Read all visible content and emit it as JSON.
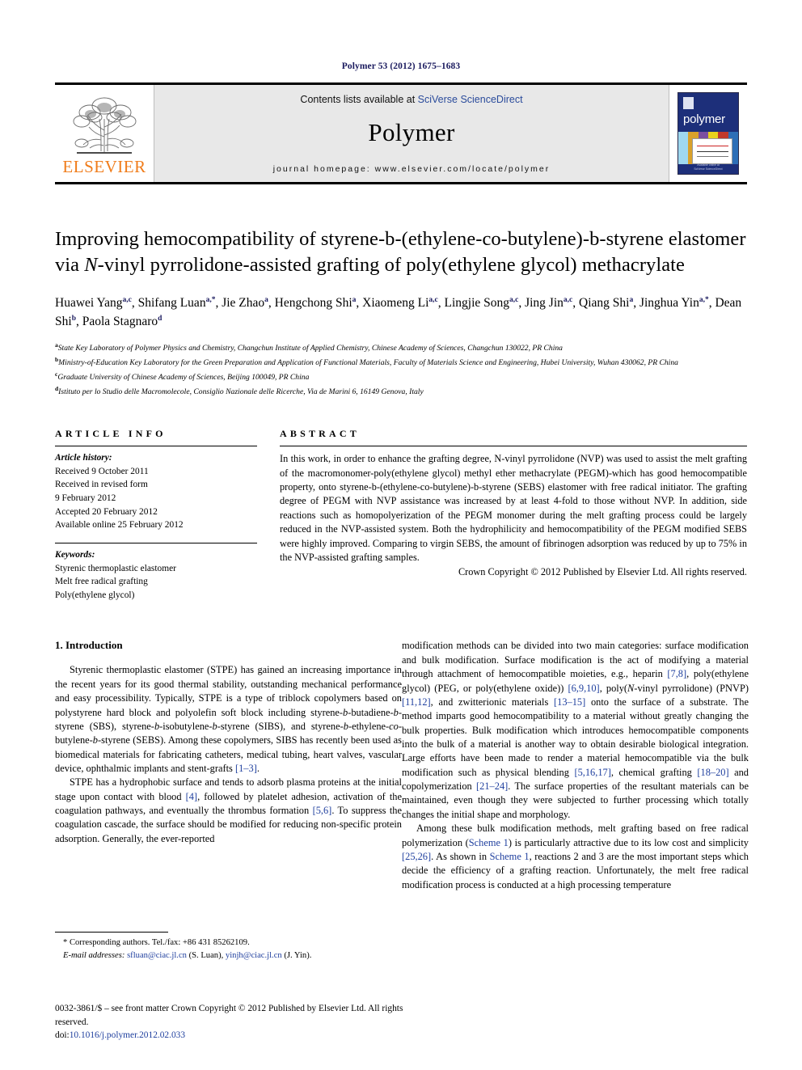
{
  "running_head": "Polymer 53 (2012) 1675–1683",
  "masthead": {
    "publisher_logo_text": "ELSEVIER",
    "contents_prefix": "Contents lists available at ",
    "contents_link": "SciVerse ScienceDirect",
    "journal_name": "Polymer",
    "homepage": "journal homepage: www.elsevier.com/locate/polymer",
    "cover": {
      "title": "polymer",
      "footer_line1": "Available online at",
      "footer_line2": "SciVerse ScienceDirect"
    }
  },
  "article": {
    "title_part1": "Improving hemocompatibility of styrene-b-(ethylene-co-butylene)-b-styrene elastomer via ",
    "title_italic": "N",
    "title_part2": "-vinyl pyrrolidone-assisted grafting of poly(ethylene glycol) methacrylate",
    "authors": [
      {
        "name": "Huawei Yang",
        "sup": "a,c",
        "sep": ", "
      },
      {
        "name": "Shifang Luan",
        "sup": "a,*",
        "sep": ", "
      },
      {
        "name": "Jie Zhao",
        "sup": "a",
        "sep": ", "
      },
      {
        "name": "Hengchong Shi",
        "sup": "a",
        "sep": ", "
      },
      {
        "name": "Xiaomeng Li",
        "sup": "a,c",
        "sep": ", "
      },
      {
        "name": "Lingjie Song",
        "sup": "a,c",
        "sep": ", "
      },
      {
        "name": "Jing Jin",
        "sup": "a,c",
        "sep": ", "
      },
      {
        "name": "Qiang Shi",
        "sup": "a",
        "sep": ", "
      },
      {
        "name": "Jinghua Yin",
        "sup": "a,*",
        "sep": ", "
      },
      {
        "name": "Dean Shi",
        "sup": "b",
        "sep": ", "
      },
      {
        "name": "Paola Stagnaro",
        "sup": "d",
        "sep": ""
      }
    ],
    "affiliations": [
      {
        "marker": "a",
        "text": "State Key Laboratory of Polymer Physics and Chemistry, Changchun Institute of Applied Chemistry, Chinese Academy of Sciences, Changchun 130022, PR China"
      },
      {
        "marker": "b",
        "text": "Ministry-of-Education Key Laboratory for the Green Preparation and Application of Functional Materials, Faculty of Materials Science and Engineering, Hubei University, Wuhan 430062, PR China"
      },
      {
        "marker": "c",
        "text": "Graduate University of Chinese Academy of Sciences, Beijing 100049, PR China"
      },
      {
        "marker": "d",
        "text": "Istituto per lo Studio delle Macromolecole, Consiglio Nazionale delle Ricerche, Via de Marini 6, 16149 Genova, Italy"
      }
    ]
  },
  "article_info": {
    "heading": "ARTICLE INFO",
    "history_label": "Article history:",
    "history": [
      "Received 9 October 2011",
      "Received in revised form",
      "9 February 2012",
      "Accepted 20 February 2012",
      "Available online 25 February 2012"
    ],
    "keywords_label": "Keywords:",
    "keywords": [
      "Styrenic thermoplastic elastomer",
      "Melt free radical grafting",
      "Poly(ethylene glycol)"
    ]
  },
  "abstract": {
    "heading": "ABSTRACT",
    "text": "In this work, in order to enhance the grafting degree, N-vinyl pyrrolidone (NVP) was used to assist the melt grafting of the macromonomer-poly(ethylene glycol) methyl ether methacrylate (PEGM)-which has good hemocompatible property, onto styrene-b-(ethylene-co-butylene)-b-styrene (SEBS) elastomer with free radical initiator. The grafting degree of PEGM with NVP assistance was increased by at least 4-fold to those without NVP. In addition, side reactions such as homopolyerization of the PEGM monomer during the melt grafting process could be largely reduced in the NVP-assisted system. Both the hydrophilicity and hemocompatibility of the PEGM modified SEBS were highly improved. Comparing to virgin SEBS, the amount of fibrinogen adsorption was reduced by up to 75% in the NVP-assisted grafting samples.",
    "copyright": "Crown Copyright © 2012 Published by Elsevier Ltd. All rights reserved."
  },
  "introduction": {
    "heading": "1. Introduction",
    "left_paragraphs": [
      "Styrenic thermoplastic elastomer (STPE) has gained an increasing importance in the recent years for its good thermal stability, outstanding mechanical performance and easy processibility. Typically, STPE is a type of triblock copolymers based on polystyrene hard block and polyolefin soft block including styrene-b-butadiene-b-styrene (SBS), styrene-b-isobutylene-b-styrene (SIBS), and styrene-b-ethylene-co-butylene-b-styrene (SEBS). Among these copolymers, SIBS has recently been used as biomedical materials for fabricating catheters, medical tubing, heart valves, vascular device, ophthalmic implants and stent-grafts [1–3].",
      "STPE has a hydrophobic surface and tends to adsorb plasma proteins at the initial stage upon contact with blood [4], followed by platelet adhesion, activation of the coagulation pathways, and eventually the thrombus formation [5,6]. To suppress the coagulation cascade, the surface should be modified for reducing non-specific protein adsorption. Generally, the ever-reported"
    ],
    "right_paragraphs": [
      "modification methods can be divided into two main categories: surface modification and bulk modification. Surface modification is the act of modifying a material through attachment of hemocompatible moieties, e.g., heparin [7,8], poly(ethylene glycol) (PEG, or poly(ethylene oxide)) [6,9,10], poly(N-vinyl pyrrolidone) (PNVP) [11,12], and zwitterionic materials [13–15] onto the surface of a substrate. The method imparts good hemocompatibility to a material without greatly changing the bulk properties. Bulk modification which introduces hemocompatible components into the bulk of a material is another way to obtain desirable biological integration. Large efforts have been made to render a material hemocompatible via the bulk modification such as physical blending [5,16,17], chemical grafting [18–20] and copolymerization [21–24]. The surface properties of the resultant materials can be maintained, even though they were subjected to further processing which totally changes the initial shape and morphology.",
      "Among these bulk modification methods, melt grafting based on free radical polymerization (Scheme 1) is particularly attractive due to its low cost and simplicity [25,26]. As shown in Scheme 1, reactions 2 and 3 are the most important steps which decide the efficiency of a grafting reaction. Unfortunately, the melt free radical modification process is conducted at a high processing temperature"
    ]
  },
  "footnotes": {
    "corresponding": "* Corresponding authors. Tel./fax: +86 431 85262109.",
    "email_label": "E-mail addresses:",
    "email1": "sfluan@ciac.jl.cn",
    "email1_who": " (S. Luan), ",
    "email2": "yinjh@ciac.jl.cn",
    "email2_who": " (J. Yin)."
  },
  "footer": {
    "issn_line": "0032-3861/$ – see front matter Crown Copyright © 2012 Published by Elsevier Ltd. All rights reserved.",
    "doi_label": "doi:",
    "doi_value": "10.1016/j.polymer.2012.02.033"
  },
  "colors": {
    "link_blue": "#1f3f9e",
    "elsevier_orange": "#f07c1a",
    "cover_blue": "#1d2f7a",
    "masthead_grey": "#e8e8e8"
  }
}
